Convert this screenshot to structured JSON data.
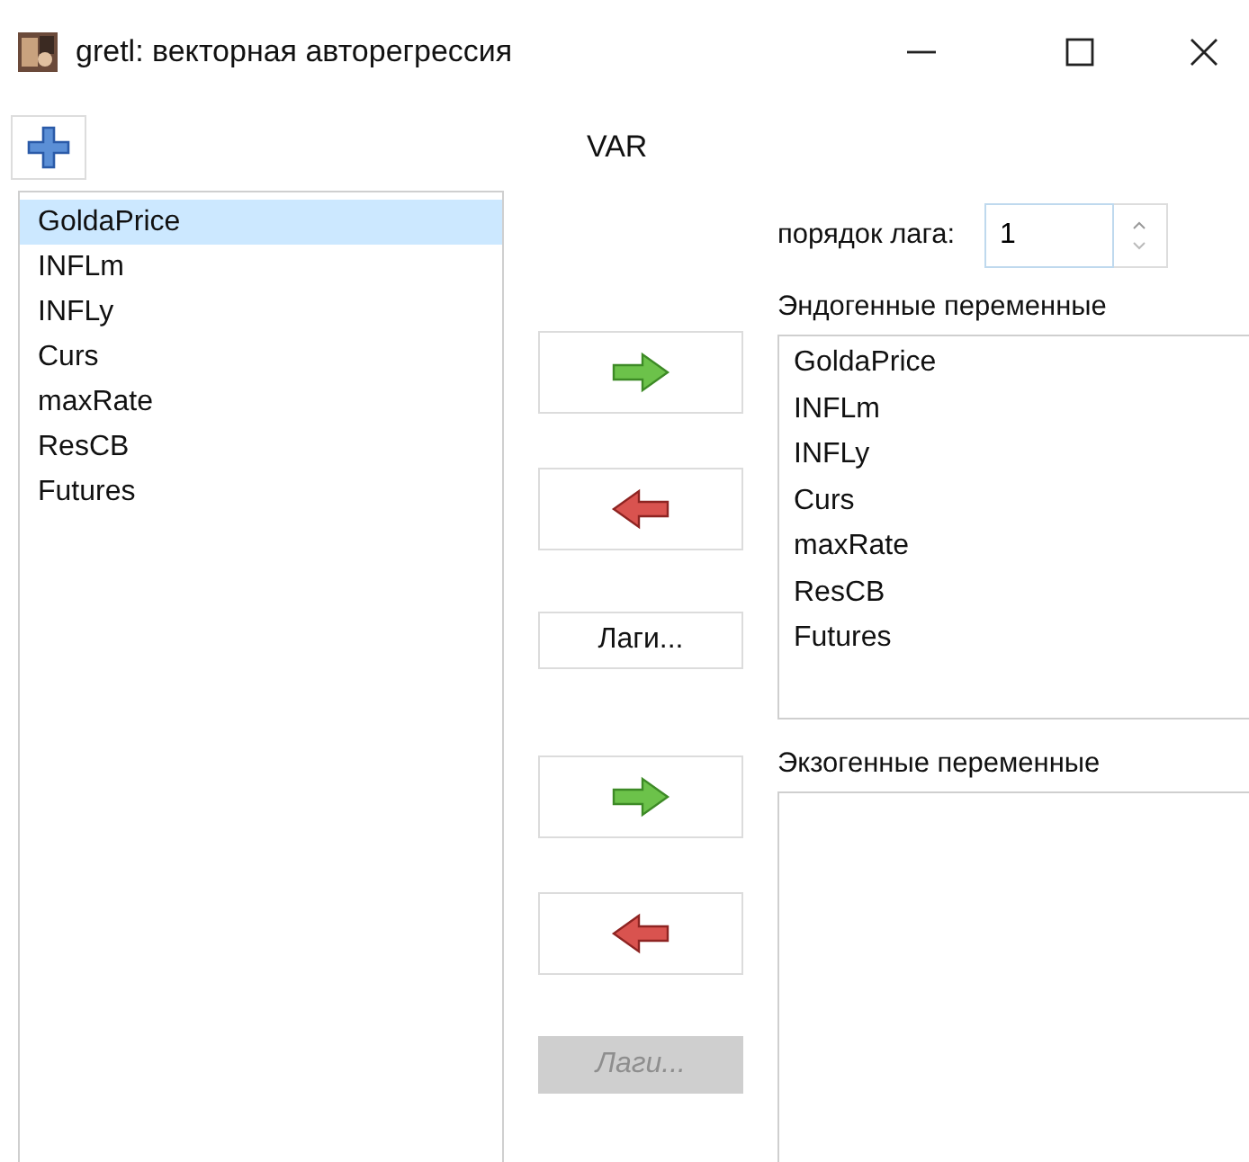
{
  "window": {
    "title": "gretl: векторная авторегрессия",
    "controls": [
      {
        "kind": "minimize"
      },
      {
        "kind": "maximize"
      },
      {
        "kind": "close"
      }
    ]
  },
  "toolbar": {
    "add_button": {
      "kind": "add"
    },
    "heading": "VAR"
  },
  "variables": [
    {
      "label": "GoldaPrice",
      "selected": true
    },
    {
      "label": "INFLm",
      "selected": false
    },
    {
      "label": "INFLy",
      "selected": false
    },
    {
      "label": "Curs",
      "selected": false
    },
    {
      "label": "maxRate",
      "selected": false
    },
    {
      "label": "ResCB",
      "selected": false
    },
    {
      "label": "Futures",
      "selected": false
    }
  ],
  "lag_order": {
    "label": "порядок лага:",
    "value": "1"
  },
  "endogenous": {
    "title": "Эндогенные переменные",
    "buttons": [
      {
        "kind": "add",
        "disabled": false
      },
      {
        "kind": "remove",
        "disabled": false
      },
      {
        "kind": "lags",
        "label": "Лаги...",
        "disabled": false
      }
    ],
    "items": [
      "GoldaPrice",
      "INFLm",
      "INFLy",
      "Curs",
      "maxRate",
      "ResCB",
      "Futures"
    ]
  },
  "exogenous": {
    "title": "Экзогенные переменные",
    "buttons": [
      {
        "kind": "add",
        "disabled": false
      },
      {
        "kind": "remove",
        "disabled": false
      },
      {
        "kind": "lags",
        "label": "Лаги...",
        "disabled": true
      }
    ]
  }
}
